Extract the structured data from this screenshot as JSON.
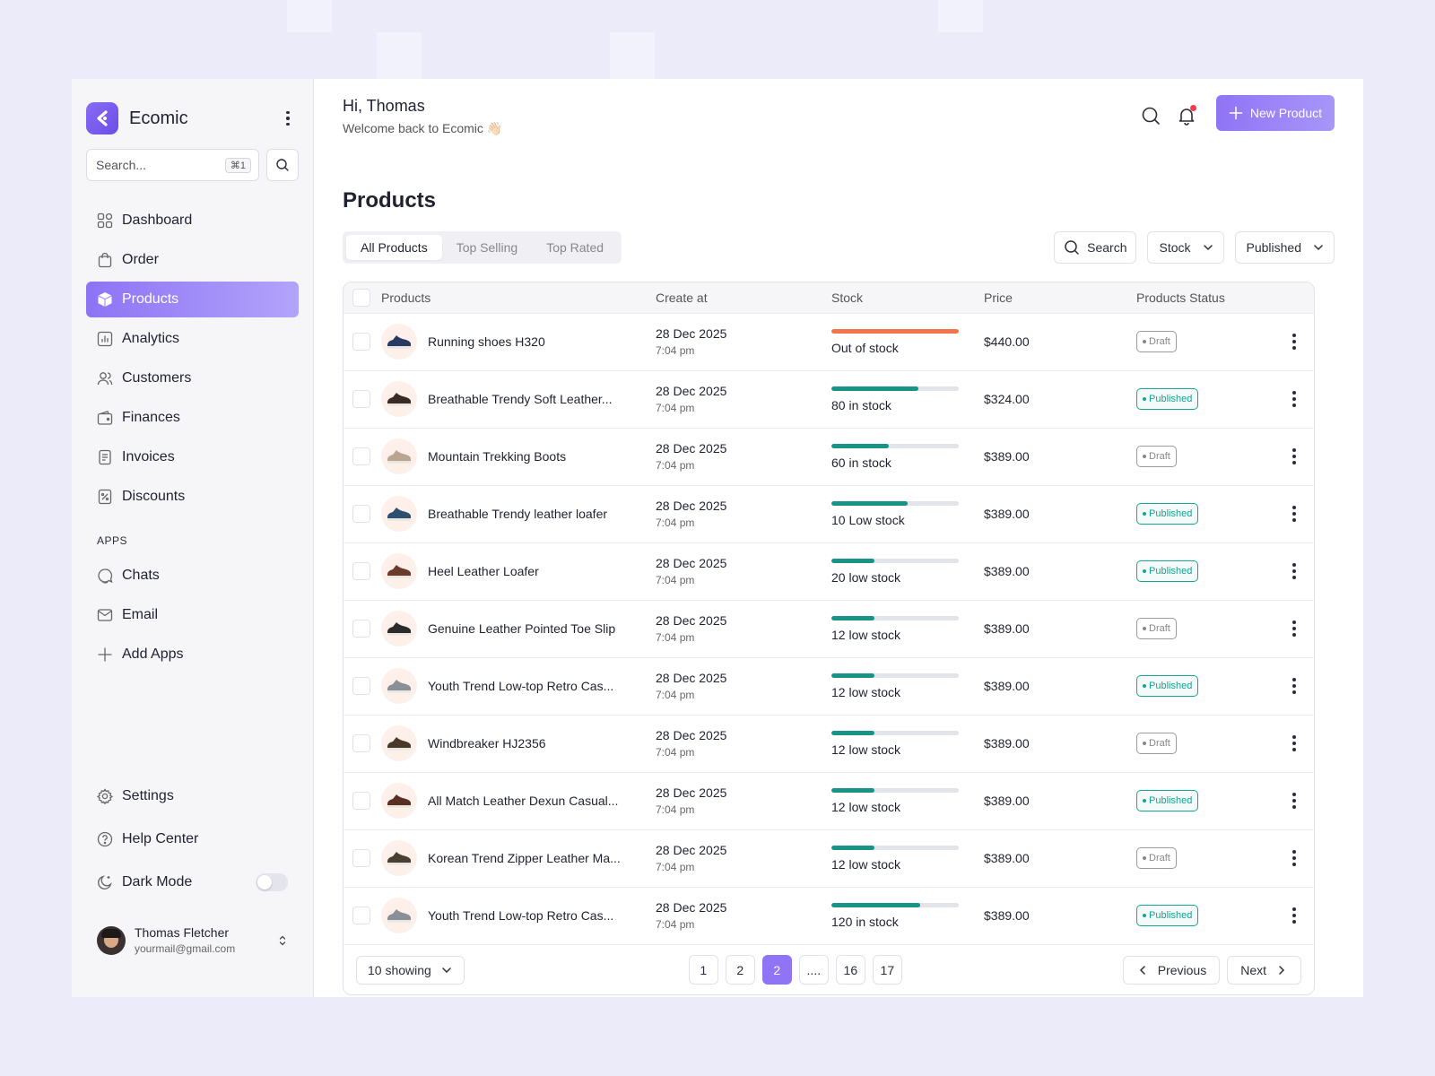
{
  "colors": {
    "accent": "#8f74f6",
    "published": "#1aa392",
    "out_of_stock": "#f2734c",
    "stock_bar": "#179486"
  },
  "sidebar": {
    "brand": "Ecomic",
    "search_placeholder": "Search...",
    "search_shortcut": "⌘1",
    "nav": [
      {
        "label": "Dashboard",
        "icon": "grid-icon"
      },
      {
        "label": "Order",
        "icon": "bag-icon"
      },
      {
        "label": "Products",
        "icon": "box-icon",
        "active": true
      },
      {
        "label": "Analytics",
        "icon": "chart-icon"
      },
      {
        "label": "Customers",
        "icon": "users-icon"
      },
      {
        "label": "Finances",
        "icon": "wallet-icon"
      },
      {
        "label": "Invoices",
        "icon": "invoice-icon"
      },
      {
        "label": "Discounts",
        "icon": "discount-icon"
      }
    ],
    "apps_heading": "APPS",
    "apps": [
      {
        "label": "Chats",
        "icon": "chat-icon"
      },
      {
        "label": "Email",
        "icon": "mail-icon"
      },
      {
        "label": "Add Apps",
        "icon": "plus-icon"
      }
    ],
    "settings": "Settings",
    "help": "Help Center",
    "dark_mode": "Dark Mode",
    "user": {
      "name": "Thomas Fletcher",
      "email": "yourmail@gmail.com"
    }
  },
  "header": {
    "greeting": "Hi, Thomas",
    "subtitle": "Welcome back to Ecomic 👋🏻",
    "new_product": "New Product"
  },
  "main": {
    "title": "Products",
    "tabs": [
      "All Products",
      "Top Selling",
      "Top Rated"
    ],
    "active_tab": 0,
    "search_label": "Search",
    "filter_stock": "Stock",
    "filter_status": "Published"
  },
  "table": {
    "columns": [
      "Products",
      "Create at",
      "Stock",
      "Price",
      "Products Status"
    ],
    "rows": [
      {
        "name": "Running shoes H320",
        "date": "28 Dec 2025",
        "time": "7:04 pm",
        "stock_label": "Out of stock",
        "stock_fill": 1.0,
        "out": true,
        "price": "$440.00",
        "status": "Draft"
      },
      {
        "name": "Breathable Trendy Soft Leather...",
        "date": "28 Dec 2025",
        "time": "7:04 pm",
        "stock_label": "80 in stock",
        "stock_fill": 0.68,
        "out": false,
        "price": "$324.00",
        "status": "Published"
      },
      {
        "name": "Mountain Trekking Boots",
        "date": "28 Dec 2025",
        "time": "7:04 pm",
        "stock_label": "60 in stock",
        "stock_fill": 0.45,
        "out": false,
        "price": "$389.00",
        "status": "Draft"
      },
      {
        "name": "Breathable Trendy leather loafer",
        "date": "28 Dec 2025",
        "time": "7:04 pm",
        "stock_label": "10 Low stock",
        "stock_fill": 0.6,
        "out": false,
        "price": "$389.00",
        "status": "Published"
      },
      {
        "name": "Heel Leather Loafer",
        "date": "28 Dec 2025",
        "time": "7:04 pm",
        "stock_label": "20 low stock",
        "stock_fill": 0.34,
        "out": false,
        "price": "$389.00",
        "status": "Published"
      },
      {
        "name": "Genuine Leather Pointed Toe Slip",
        "date": "28 Dec 2025",
        "time": "7:04 pm",
        "stock_label": "12 low stock",
        "stock_fill": 0.34,
        "out": false,
        "price": "$389.00",
        "status": "Draft"
      },
      {
        "name": "Youth Trend Low-top Retro Cas...",
        "date": "28 Dec 2025",
        "time": "7:04 pm",
        "stock_label": "12 low stock",
        "stock_fill": 0.34,
        "out": false,
        "price": "$389.00",
        "status": "Published"
      },
      {
        "name": "Windbreaker HJ2356",
        "date": "28 Dec 2025",
        "time": "7:04 pm",
        "stock_label": "12 low stock",
        "stock_fill": 0.34,
        "out": false,
        "price": "$389.00",
        "status": "Draft"
      },
      {
        "name": "All Match Leather Dexun Casual...",
        "date": "28 Dec 2025",
        "time": "7:04 pm",
        "stock_label": "12 low stock",
        "stock_fill": 0.34,
        "out": false,
        "price": "$389.00",
        "status": "Published"
      },
      {
        "name": "Korean Trend Zipper Leather Ma...",
        "date": "28 Dec 2025",
        "time": "7:04 pm",
        "stock_label": "12 low stock",
        "stock_fill": 0.34,
        "out": false,
        "price": "$389.00",
        "status": "Draft"
      },
      {
        "name": "Youth Trend Low-top Retro Cas...",
        "date": "28 Dec 2025",
        "time": "7:04 pm",
        "stock_label": "120 in stock",
        "stock_fill": 0.7,
        "out": false,
        "price": "$389.00",
        "status": "Published"
      }
    ]
  },
  "pagination": {
    "showing": "10 showing",
    "pages": [
      "1",
      "2",
      "2",
      "....",
      "16",
      "17"
    ],
    "active_index": 2,
    "previous": "Previous",
    "next": "Next"
  }
}
